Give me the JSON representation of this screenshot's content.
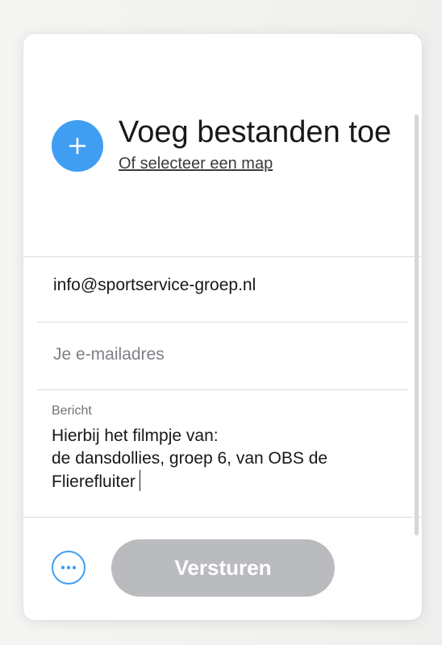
{
  "upload": {
    "title": "Voeg bestanden toe",
    "select_folder_link": "Of selecteer een map",
    "add_icon": "plus-icon",
    "accent_color": "#409ef2"
  },
  "recipient": {
    "value": "info@sportservice-groep.nl"
  },
  "sender": {
    "value": "",
    "placeholder": "Je e-mailadres"
  },
  "message": {
    "label": "Bericht",
    "text": "Hierbij het filmpje van:\nde dansdollies, groep 6, van OBS de Flierefluiter"
  },
  "footer": {
    "more_icon": "more-options-icon",
    "send_label": "Versturen",
    "send_button_color": "#babbbf"
  }
}
